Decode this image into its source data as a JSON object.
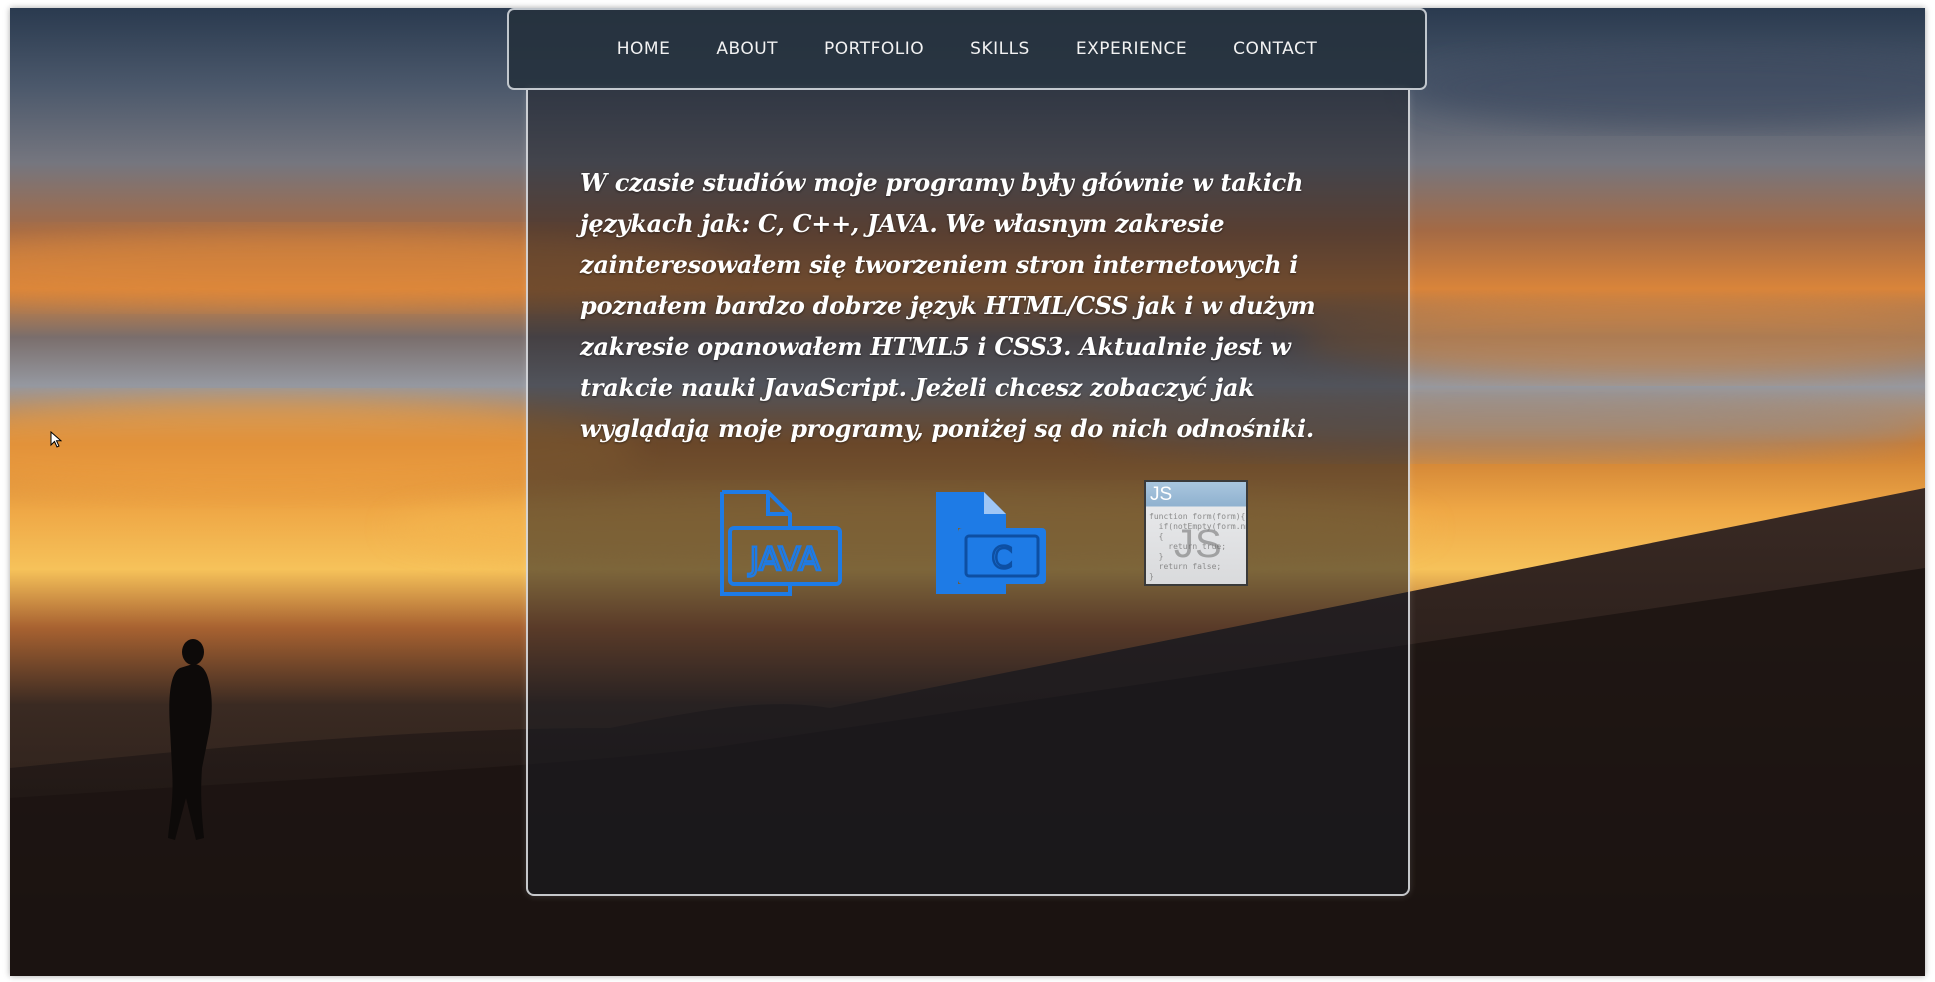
{
  "nav": {
    "items": [
      {
        "label": "HOME"
      },
      {
        "label": "ABOUT"
      },
      {
        "label": "PORTFOLIO"
      },
      {
        "label": "SKILLS"
      },
      {
        "label": "EXPERIENCE"
      },
      {
        "label": "CONTACT"
      }
    ]
  },
  "main": {
    "intro": "W czasie studiów moje programy były głównie w takich językach jak: C, C++, JAVA. We własnym zakresie zainteresowałem się tworzeniem stron internetowych i poznałem bardzo dobrze język HTML/CSS jak i w dużym zakresie opanowałem HTML5 i CSS3. Aktualnie jest w trakcie nauki JavaScript. Jeżeli chcesz zobaczyć jak wyglądają moje programy, poniżej są do nich odnośniki.",
    "icons": [
      {
        "name": "java-file-icon",
        "label": "JAVA"
      },
      {
        "name": "c-file-icon",
        "label": "C"
      },
      {
        "name": "js-file-icon",
        "label": "JS",
        "code": "function form(form){\n  if(notEmpty(form.nm)\n  {\n    return true;\n  }\n  return false;\n}"
      }
    ]
  },
  "colors": {
    "accent": "#1e7be6",
    "panel_border": "#e6e8ec",
    "nav_bg": "#26323e"
  }
}
